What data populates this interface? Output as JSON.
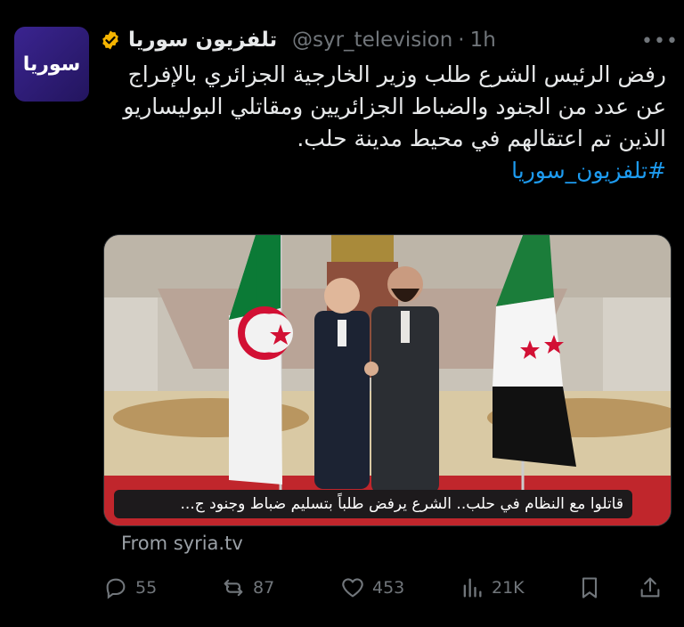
{
  "tweet": {
    "display_name": "تلفزيون سوريا",
    "handle": "@syr_television",
    "separator": "·",
    "time": "1h",
    "more_label": "•••",
    "avatar_logo": "سوريا",
    "body_text": "رفض الرئيس الشرع طلب وزير الخارجية الجزائري بالإفراج عن عدد من الجنود والضباط الجزائريين ومقاتلي البوليساريو الذين تم اعتقالهم في محيط مدينة حلب.",
    "hashtag": "#تلفزيون_سوريا",
    "media_caption": "قاتلوا مع النظام في حلب.. الشرع يرفض طلباً بتسليم ضباط وجنود ج...",
    "source_link": "From syria.tv",
    "verified_color": "#f5b400"
  },
  "actions": {
    "replies": "55",
    "reposts": "87",
    "likes": "453",
    "views": "21K"
  },
  "icons": [
    "verified-badge-icon",
    "reply-icon",
    "repost-icon",
    "like-icon",
    "views-icon",
    "bookmark-icon",
    "share-icon",
    "more-icon"
  ]
}
